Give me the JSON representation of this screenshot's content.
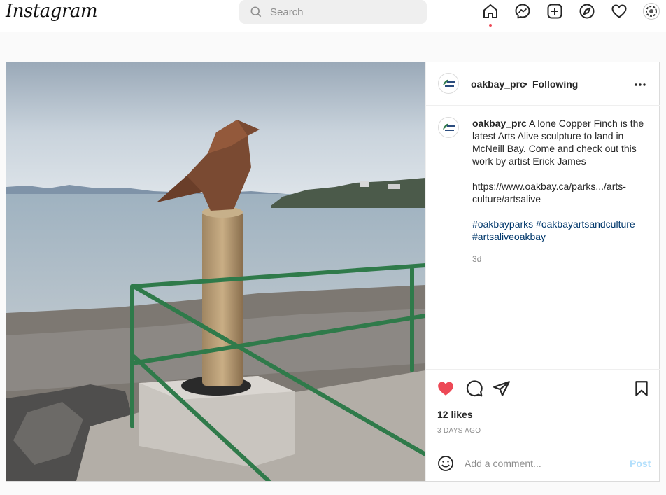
{
  "brand": {
    "logo_text": "Instagram"
  },
  "search": {
    "placeholder": "Search"
  },
  "nav": {
    "icons": [
      "home-icon",
      "messenger-icon",
      "new-post-icon",
      "explore-icon",
      "activity-heart-icon",
      "profile-avatar"
    ],
    "active": "home-icon",
    "notification_dot_color": "#ed4956"
  },
  "post": {
    "username": "oakbay_prc",
    "separator": "•",
    "follow_status": "Following",
    "caption": {
      "username": "oakbay_prc",
      "text": "A lone Copper Finch is the latest Arts Alive sculpture to land in McNeill Bay. Come and check out this work by artist Erick James",
      "link": "https://www.oakbay.ca/parks.../arts-culture/artsalive",
      "hashtags": "#oakbayparks #oakbayartsandculture #artsaliveoakbay",
      "time": "3d"
    },
    "likes": "12 likes",
    "date": "3 DAYS AGO",
    "liked": true,
    "like_color": "#ed4956",
    "comment": {
      "placeholder": "Add a comment...",
      "post_label": "Post"
    },
    "image": "photo of an origami-style copper bird sculpture on a wooden post by the sea with green railings"
  }
}
